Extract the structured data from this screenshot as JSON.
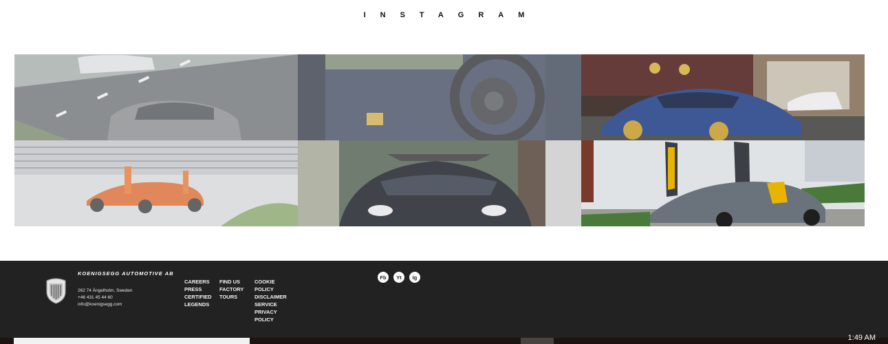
{
  "instagram": {
    "title": "INSTAGRAM"
  },
  "gallery": [
    {
      "name": "photo-highway-cars"
    },
    {
      "name": "photo-steering-wheel"
    },
    {
      "name": "photo-blue-car-garage"
    },
    {
      "name": "photo-orange-car-doors-open"
    },
    {
      "name": "photo-car-front-view"
    },
    {
      "name": "photo-grey-car-doors-up"
    }
  ],
  "footer": {
    "company": "KOENIGSEGG AUTOMOTIVE AB",
    "address": [
      "262 74 Ängelholm, Sweden",
      "+46 431 45 44 60",
      "info@koenigsegg.com"
    ],
    "links_col1": [
      "CAREERS",
      "PRESS",
      "CERTIFIED",
      "LEGENDS"
    ],
    "links_col2": [
      "FIND US",
      "FACTORY",
      "TOURS"
    ],
    "links_col3": [
      "COOKIE",
      "POLICY",
      "DISCLAIMER",
      "SERVICE",
      "PRIVACY",
      "POLICY"
    ],
    "social": [
      "Fb",
      "Yt",
      "Ig"
    ]
  },
  "taskbar": {
    "clock": "1:49 AM"
  },
  "colors": {
    "footer_bg": "#222222",
    "accent_yellow": "#e8b400"
  }
}
